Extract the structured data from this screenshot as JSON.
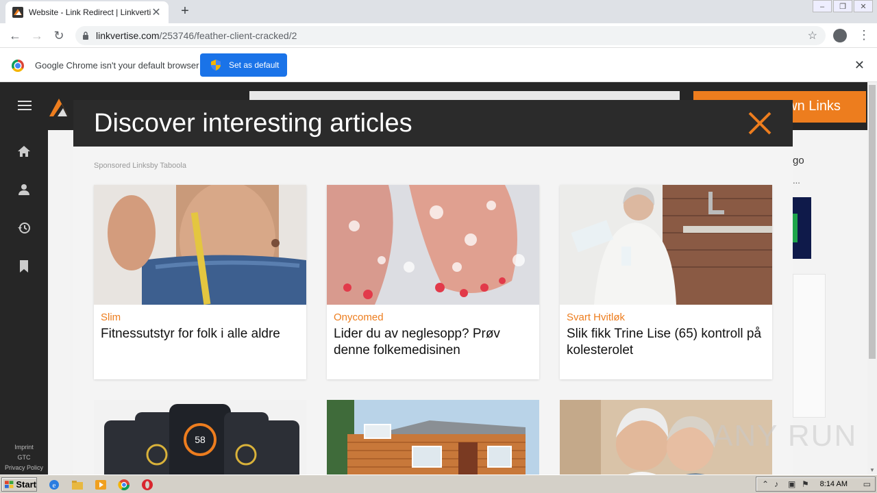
{
  "browser": {
    "tab_title": "Website - Link Redirect | Linkvertise",
    "url_domain": "linkvertise.com",
    "url_path": "/253746/feather-client-cracked/2",
    "infobar_message": "Google Chrome isn't your default browser",
    "infobar_button": "Set as default"
  },
  "site": {
    "header_button": "own Links",
    "right_text_1": "go",
    "right_text_2": "...",
    "footer_links": [
      "Imprint",
      "GTC",
      "Privacy Policy"
    ]
  },
  "modal": {
    "title": "Discover interesting articles",
    "sponsored": "Sponsored Linksby Taboola",
    "cards": [
      {
        "brand": "Slim",
        "title": "Fitnessutstyr for folk i alle aldre"
      },
      {
        "brand": "Onycomed",
        "title": "Lider du av neglesopp? Prøv denne folkemedisinen"
      },
      {
        "brand": "Svart Hvitløk",
        "title": "Slik fikk Trine Lise (65) kontroll på kolesterolet"
      }
    ],
    "phone_value": "58"
  },
  "watermark": "ANY RUN",
  "taskbar": {
    "start_label": "Start",
    "clock": "8:14 AM"
  },
  "colors": {
    "accent_orange": "#ed7d1e",
    "chrome_blue": "#1a73e8",
    "dark_header": "#262626"
  }
}
